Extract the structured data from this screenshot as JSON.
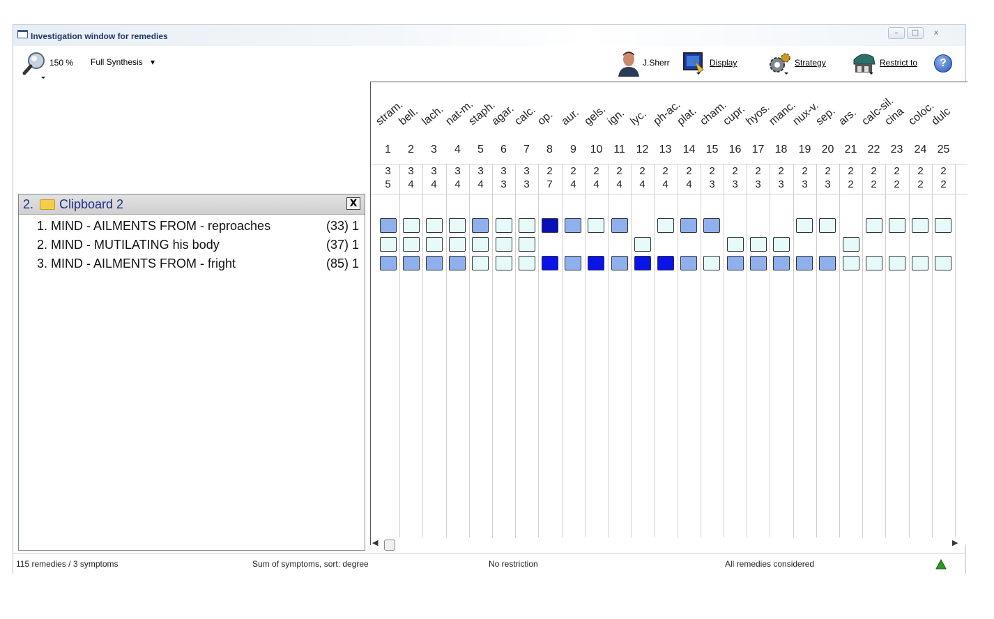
{
  "window": {
    "title": "Investigation window for remedies",
    "controls": [
      "–",
      "□",
      "x"
    ]
  },
  "toolbar": {
    "zoom": "150 %",
    "mode": "Full Synthesis",
    "mode_arrow": "▾",
    "user": "J.Sherr",
    "display": "Display",
    "strategy": "Strategy",
    "restrict": "Restrict to",
    "help": "?"
  },
  "clipboard": {
    "title": "2. ",
    "name": "Clipboard 2",
    "close": "X",
    "symptoms": [
      {
        "label": "1. MIND - AILMENTS FROM - reproaches",
        "count": "(33) 1"
      },
      {
        "label": "2. MIND - MUTILATING his body",
        "count": "(37) 1"
      },
      {
        "label": "3. MIND - AILMENTS FROM - fright",
        "count": "(85) 1"
      }
    ]
  },
  "remedies": [
    {
      "name": "stram.",
      "num": "1",
      "v1": "3",
      "v2": "5"
    },
    {
      "name": "bell.",
      "num": "2",
      "v1": "3",
      "v2": "4"
    },
    {
      "name": "lach.",
      "num": "3",
      "v1": "3",
      "v2": "4"
    },
    {
      "name": "nat-m.",
      "num": "4",
      "v1": "3",
      "v2": "4"
    },
    {
      "name": "staph.",
      "num": "5",
      "v1": "3",
      "v2": "4"
    },
    {
      "name": "agar.",
      "num": "6",
      "v1": "3",
      "v2": "3"
    },
    {
      "name": "calc.",
      "num": "7",
      "v1": "3",
      "v2": "3"
    },
    {
      "name": "op.",
      "num": "8",
      "v1": "2",
      "v2": "7"
    },
    {
      "name": "aur.",
      "num": "9",
      "v1": "2",
      "v2": "4"
    },
    {
      "name": "gels.",
      "num": "10",
      "v1": "2",
      "v2": "4"
    },
    {
      "name": "ign.",
      "num": "11",
      "v1": "2",
      "v2": "4"
    },
    {
      "name": "lyc.",
      "num": "12",
      "v1": "2",
      "v2": "4"
    },
    {
      "name": "ph-ac.",
      "num": "13",
      "v1": "2",
      "v2": "4"
    },
    {
      "name": "plat.",
      "num": "14",
      "v1": "2",
      "v2": "4"
    },
    {
      "name": "cham.",
      "num": "15",
      "v1": "2",
      "v2": "3"
    },
    {
      "name": "cupr.",
      "num": "16",
      "v1": "2",
      "v2": "3"
    },
    {
      "name": "hyos.",
      "num": "17",
      "v1": "2",
      "v2": "3"
    },
    {
      "name": "manc.",
      "num": "18",
      "v1": "2",
      "v2": "3"
    },
    {
      "name": "nux-v.",
      "num": "19",
      "v1": "2",
      "v2": "3"
    },
    {
      "name": "sep.",
      "num": "20",
      "v1": "2",
      "v2": "3"
    },
    {
      "name": "ars.",
      "num": "21",
      "v1": "2",
      "v2": "2"
    },
    {
      "name": "calc-sil.",
      "num": "22",
      "v1": "2",
      "v2": "2"
    },
    {
      "name": "cina",
      "num": "23",
      "v1": "2",
      "v2": "2"
    },
    {
      "name": "coloc.",
      "num": "24",
      "v1": "2",
      "v2": "2"
    },
    {
      "name": "dulc",
      "num": "25",
      "v1": "2",
      "v2": "2"
    }
  ],
  "grades": [
    [
      2,
      1,
      1,
      1,
      2,
      1,
      1,
      4,
      2,
      1,
      2,
      0,
      1,
      2,
      2,
      0,
      0,
      0,
      1,
      1,
      0,
      1,
      1,
      1,
      1
    ],
    [
      1,
      1,
      1,
      1,
      1,
      1,
      1,
      0,
      0,
      0,
      0,
      1,
      0,
      0,
      0,
      1,
      1,
      1,
      0,
      0,
      1,
      0,
      0,
      0,
      0
    ],
    [
      2,
      2,
      2,
      2,
      1,
      1,
      1,
      3,
      2,
      3,
      2,
      3,
      3,
      2,
      1,
      2,
      2,
      2,
      2,
      2,
      1,
      1,
      1,
      1,
      1
    ]
  ],
  "grade_colors": {
    "0": "#ffffff",
    "1": "#e6fafa",
    "2": "#8fb0ec",
    "3": "#0a14e6",
    "4": "#0a10b8"
  },
  "status": {
    "counts": "115 remedies / 3 symptoms",
    "sort": "Sum of symptoms, sort: degree",
    "restriction": "No restriction",
    "considered": "All remedies considered"
  }
}
